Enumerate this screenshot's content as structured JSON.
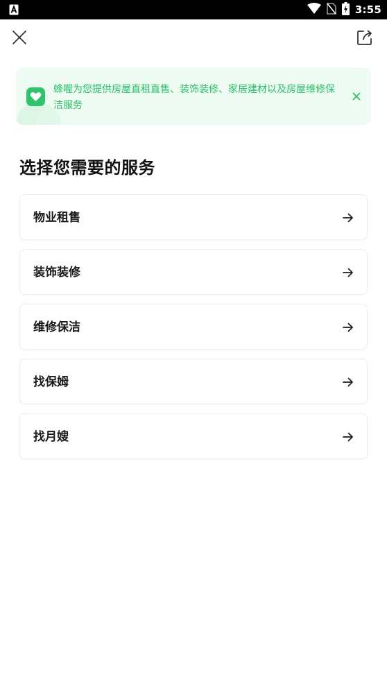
{
  "status_bar": {
    "time": "3:55",
    "icons": [
      "notification-a-icon",
      "wifi-icon",
      "no-sim-icon",
      "battery-charging-icon"
    ]
  },
  "nav": {
    "close_icon": "close-icon",
    "share_icon": "share-icon"
  },
  "banner": {
    "text": "蜂喔为您提供房屋直租直售、装饰装修、家居建材以及房屋维修保洁服务",
    "icon": "heart-icon",
    "close_icon": "close-icon",
    "accent_color": "#2fc46a",
    "background_color": "#edfbf2"
  },
  "page_title": "选择您需要的服务",
  "services": [
    {
      "label": "物业租售"
    },
    {
      "label": "装饰装修"
    },
    {
      "label": "维修保洁"
    },
    {
      "label": "找保姆"
    },
    {
      "label": "找月嫂"
    }
  ]
}
